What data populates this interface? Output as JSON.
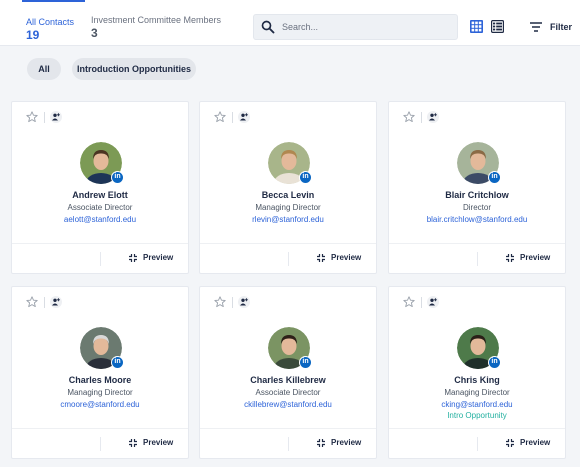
{
  "tabs": [
    {
      "label": "All Contacts",
      "count": "19"
    },
    {
      "label": "Investment Committee Members",
      "count": "3"
    }
  ],
  "search": {
    "placeholder": "Search..."
  },
  "filter": {
    "label": "Filter"
  },
  "pills": [
    {
      "label": "All"
    },
    {
      "label": "Introduction Opportunities"
    }
  ],
  "icons": {
    "search": "search-icon",
    "grid_view": "grid-view-icon",
    "list_view": "list-view-icon",
    "filter": "filter-icon",
    "star": "star-icon",
    "add_person": "add-person-icon",
    "linkedin": "linkedin-icon",
    "preview": "preview-icon"
  },
  "colors": {
    "accent": "#2d63d8",
    "linkedin": "#0a66c2",
    "intro": "#23b0a0"
  },
  "linkedin_badge": "in",
  "preview_label": "Preview",
  "contacts": [
    {
      "name": "Andrew Elott",
      "title": "Associate Director",
      "email": "aelott@stanford.edu",
      "intro": ""
    },
    {
      "name": "Becca Levin",
      "title": "Managing Director",
      "email": "rlevin@stanford.edu",
      "intro": ""
    },
    {
      "name": "Blair Critchlow",
      "title": "Director",
      "email": "blair.critchlow@stanford.edu",
      "intro": ""
    },
    {
      "name": "Charles Moore",
      "title": "Managing Director",
      "email": "cmoore@stanford.edu",
      "intro": ""
    },
    {
      "name": "Charles Killebrew",
      "title": "Associate Director",
      "email": "ckillebrew@stanford.edu",
      "intro": ""
    },
    {
      "name": "Chris King",
      "title": "Managing Director",
      "email": "cking@stanford.edu",
      "intro": "Intro Opportunity"
    }
  ]
}
